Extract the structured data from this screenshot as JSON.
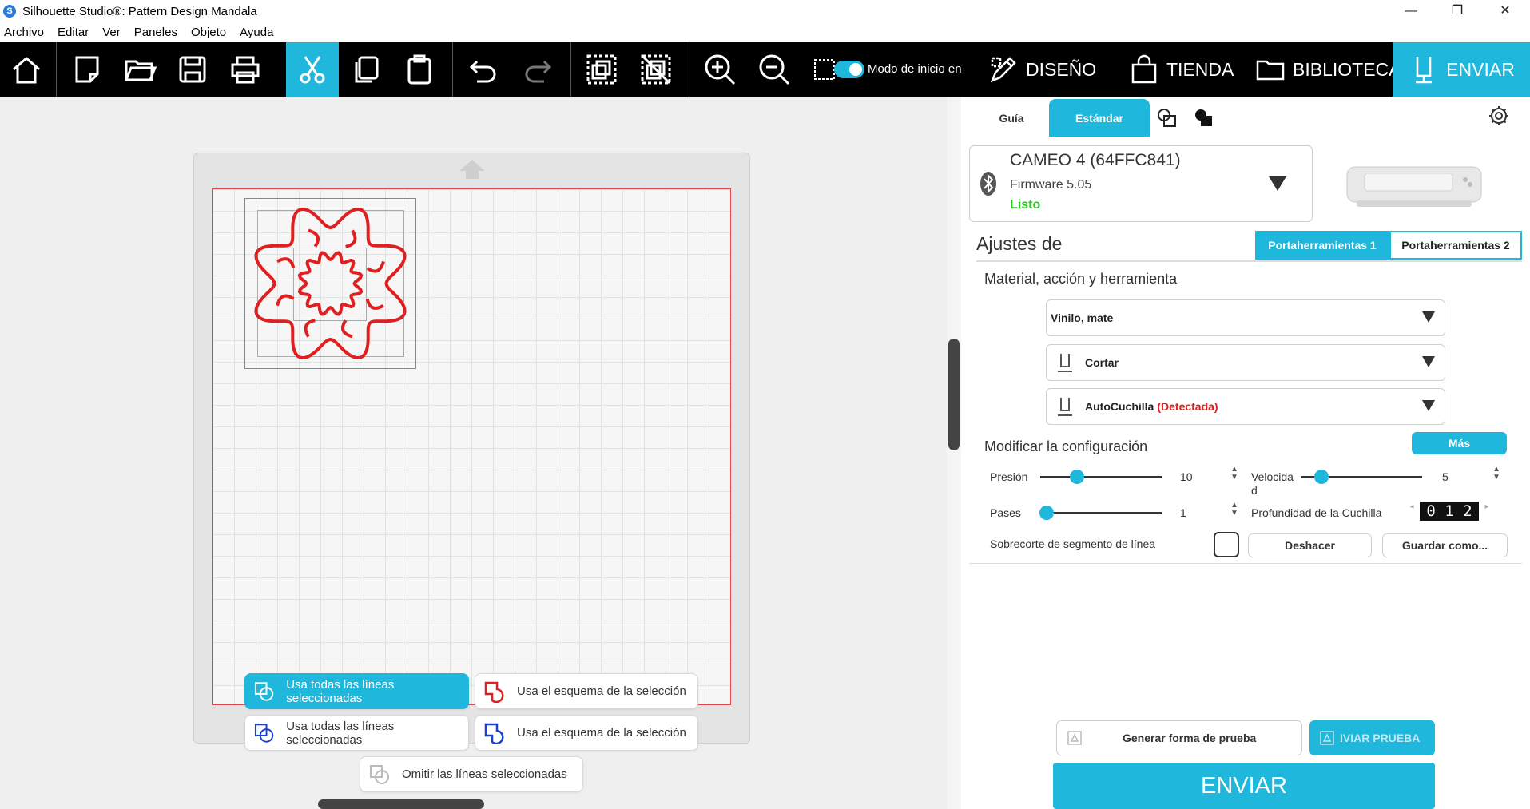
{
  "window": {
    "title": "Silhouette Studio®: Pattern Design Mandala",
    "minimize": "—",
    "restore": "❐",
    "close": "✕"
  },
  "menu": [
    "Archivo",
    "Editar",
    "Ver",
    "Paneles",
    "Objeto",
    "Ayuda"
  ],
  "toolbar": {
    "mode_toggle_label": "Modo de inicio en",
    "nav": {
      "design": "DISEÑO",
      "store": "TIENDA",
      "library": "BIBLIOTECA",
      "send": "ENVIAR"
    }
  },
  "canvas_options": {
    "row1_left": "Usa todas las líneas seleccionadas",
    "row1_right": "Usa el esquema de la selección",
    "row2_left": "Usa todas las líneas seleccionadas",
    "row2_right": "Usa el esquema de la selección",
    "row3": "Omitir las líneas seleccionadas"
  },
  "panel": {
    "tabs": {
      "guide": "Guía",
      "standard": "Estándar"
    },
    "device": {
      "name": "CAMEO 4 (64FFC841)",
      "firmware": "Firmware 5.05",
      "status": "Listo"
    },
    "settings_heading": "Ajustes de",
    "toolholder_1": "Portaherramientas 1",
    "toolholder_2": "Portaherramientas 2",
    "material_heading": "Material, acción y herramienta",
    "material": "Vinilo, mate",
    "action": "Cortar",
    "tool": "AutoCuchilla",
    "tool_detected": "(Detectada)",
    "modify_heading": "Modificar la configuración",
    "more_button": "Más",
    "pressure_label": "Presión",
    "pressure_value": "10",
    "pressure_fraction": 0.3,
    "speed_label": "Velocida d",
    "speed_value": "5",
    "speed_fraction": 0.17,
    "passes_label": "Pases",
    "passes_value": "1",
    "passes_fraction": 0.05,
    "depth_label": "Profundidad de la Cuchilla",
    "depth_digits": "0 1 2",
    "overcut_label": "Sobrecorte de segmento de línea",
    "undo_button": "Deshacer",
    "save_as_button": "Guardar como...",
    "test_shape_button": "Generar forma de prueba",
    "send_test_button": "IVIAR PRUEBA",
    "send_button": "ENVIAR"
  },
  "colors": {
    "accent": "#1fb8dc",
    "toolbar_bg": "#000000",
    "status_ok": "#22cc22",
    "cut_line": "#e02020",
    "detected": "#e02020"
  }
}
